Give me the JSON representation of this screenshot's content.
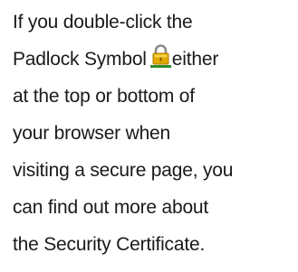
{
  "paragraph": {
    "lines": [
      "If you double-click the",
      "Padlock Symbol",
      "either",
      "at the top or bottom of",
      "your browser when",
      "visiting a secure page, you",
      "can find out more about",
      "the Security Certificate."
    ]
  },
  "icons": {
    "padlock": "padlock-icon"
  },
  "colors": {
    "text": "#1a1a1a",
    "padlock_body": "#e0a800",
    "padlock_shackle": "#8a8a8a",
    "padlock_underline": "#2e8b2e"
  }
}
